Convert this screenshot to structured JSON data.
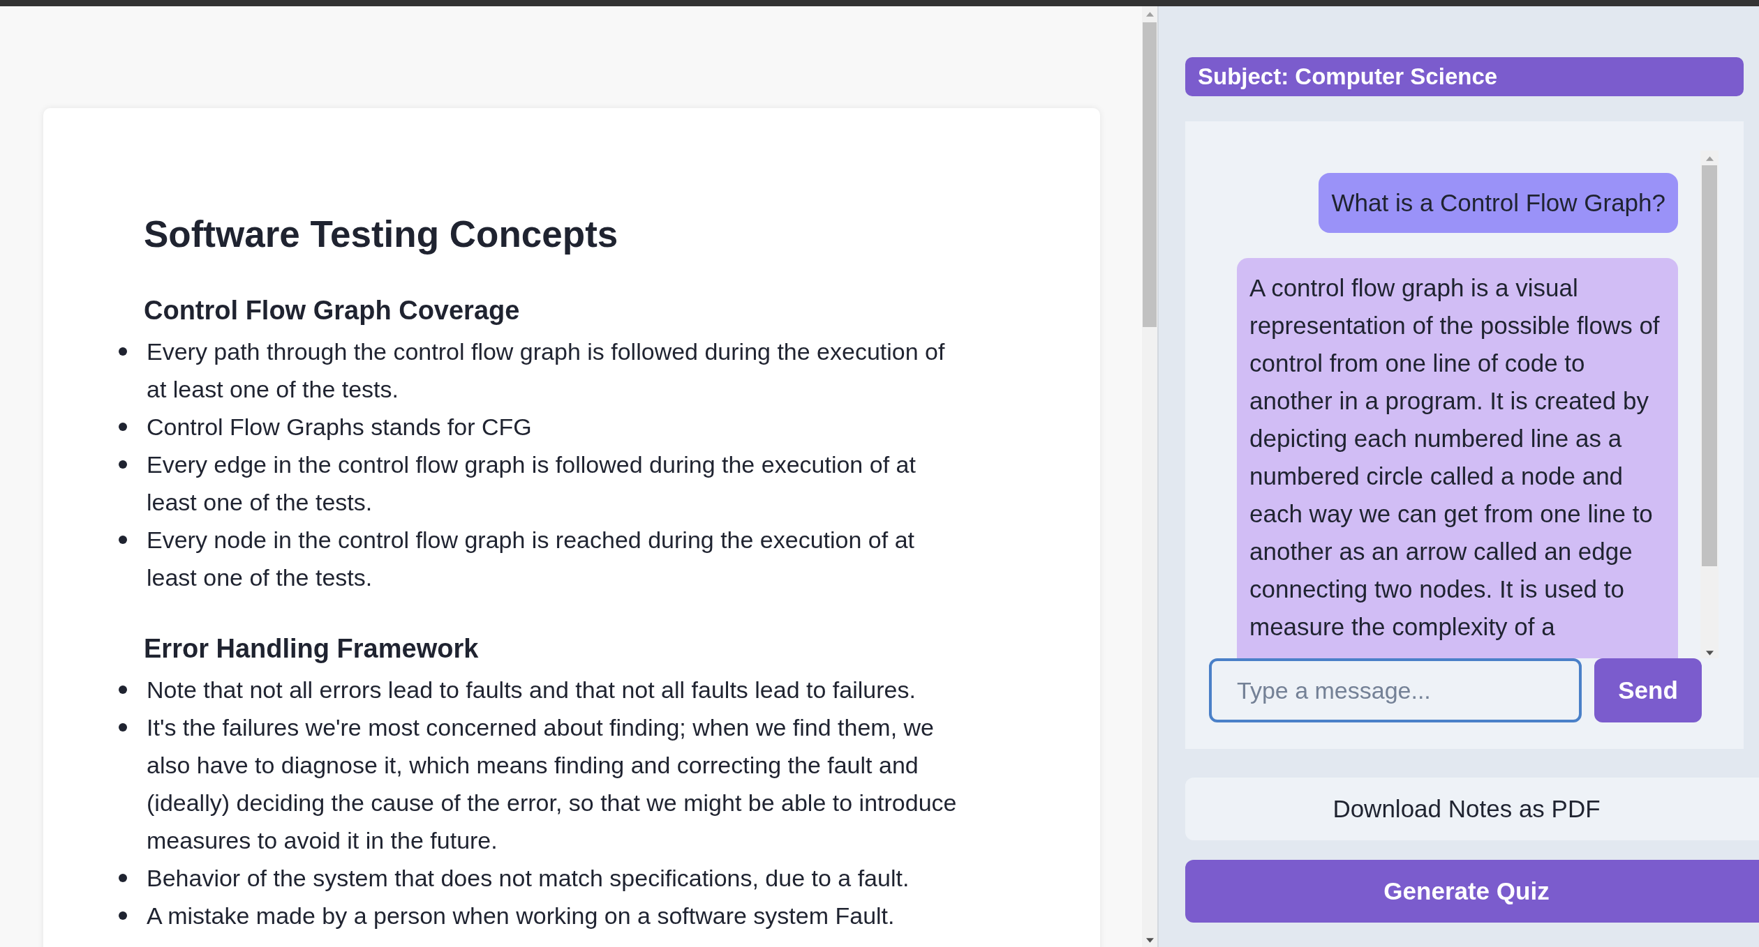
{
  "notes": {
    "title": "Software Testing Concepts",
    "sections": [
      {
        "heading": "Control Flow Graph Coverage",
        "items": [
          "Every path through the control flow graph is followed during the execution of at least one of the tests.",
          "Control Flow Graphs stands for CFG",
          "Every edge in the control flow graph is followed during the execution of at least one of the tests.",
          "Every node in the control flow graph is reached during the execution of at least one of the tests."
        ]
      },
      {
        "heading": "Error Handling Framework",
        "items": [
          "Note that not all errors lead to faults and that not all faults lead to failures.",
          "It's the failures we're most concerned about finding; when we find them, we also have to diagnose it, which means finding and correcting the fault and (ideally) deciding the cause of the error, so that we might be able to introduce measures to avoid it in the future.",
          "Behavior of the system that does not match specifications, due to a fault.",
          "A mistake made by a person when working on a software system Fault."
        ]
      }
    ]
  },
  "subject": "Subject: Computer Science",
  "chat": {
    "messages": [
      {
        "kind": "user",
        "text": "What is a Control Flow Graph?"
      },
      {
        "kind": "bot",
        "text": "A control flow graph is a visual representation of the possible flows of control from one line of code to another in a program. It is created by depicting each numbered line as a numbered circle called a node and each way we can get from one line to another as an arrow called an edge connecting two nodes. It is used to measure the complexity of a"
      }
    ],
    "input": {
      "placeholder": "Type a message..."
    },
    "send": "Send"
  },
  "buttons": [
    {
      "kind": "secondary",
      "label": "Download Notes as PDF"
    },
    {
      "kind": "primary",
      "label": "Generate Quiz"
    }
  ]
}
